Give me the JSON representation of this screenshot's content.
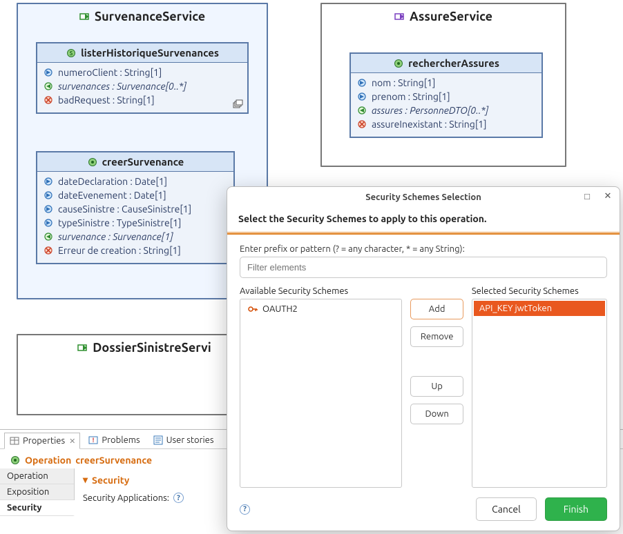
{
  "services": {
    "survenance": {
      "title": "SurvenanceService",
      "ops": {
        "lister": {
          "title": "listerHistoriqueSurvenances",
          "rows": [
            {
              "kind": "in",
              "label": "numeroClient : String[1]"
            },
            {
              "kind": "out",
              "label": "survenances : Survenance[0..*]",
              "italic": true
            },
            {
              "kind": "err",
              "label": "badRequest : String[1]"
            }
          ]
        },
        "creer": {
          "title": "creerSurvenance",
          "rows": [
            {
              "kind": "in",
              "label": "dateDeclaration : Date[1]"
            },
            {
              "kind": "in",
              "label": "dateEvenement : Date[1]"
            },
            {
              "kind": "in",
              "label": "causeSinistre : CauseSinistre[1]"
            },
            {
              "kind": "in",
              "label": "typeSinistre : TypeSinistre[1]"
            },
            {
              "kind": "out",
              "label": "survenance : Survenance[1]",
              "italic": true
            },
            {
              "kind": "err",
              "label": "Erreur de creation : String[1]"
            }
          ]
        }
      }
    },
    "assure": {
      "title": "AssureService",
      "ops": {
        "rechercher": {
          "title": "rechercherAssures",
          "rows": [
            {
              "kind": "in",
              "label": "nom : String[1]"
            },
            {
              "kind": "in",
              "label": "prenom : String[1]"
            },
            {
              "kind": "out",
              "label": "assures : PersonneDTO[0..*]",
              "italic": true
            },
            {
              "kind": "err",
              "label": "assureInexistant : String[1]"
            }
          ]
        }
      }
    },
    "dossier": {
      "title": "DossierSinistreServi"
    }
  },
  "panels": {
    "tabs": {
      "properties": "Properties",
      "problems": "Problems",
      "userstories": "User stories"
    },
    "header_prefix": "Operation ",
    "header_name": "creerSurvenance",
    "vtabs": {
      "operation": "Operation",
      "exposition": "Exposition",
      "security": "Security"
    },
    "security": {
      "heading": "Security",
      "applications_label": "Security Applications:"
    }
  },
  "dialog": {
    "title": "Security Schemes Selection",
    "instruction": "Select the Security Schemes to apply to this operation.",
    "filter_label": "Enter prefix or pattern (? = any character, * = any String):",
    "filter_placeholder": "Filter elements",
    "available_label": "Available Security Schemes",
    "selected_label": "Selected Security Schemes",
    "available": [
      {
        "label": "OAUTH2"
      }
    ],
    "selected": [
      {
        "label": "API_KEY jwtToken"
      }
    ],
    "buttons": {
      "add": "Add",
      "remove": "Remove",
      "up": "Up",
      "down": "Down",
      "cancel": "Cancel",
      "finish": "Finish"
    }
  }
}
